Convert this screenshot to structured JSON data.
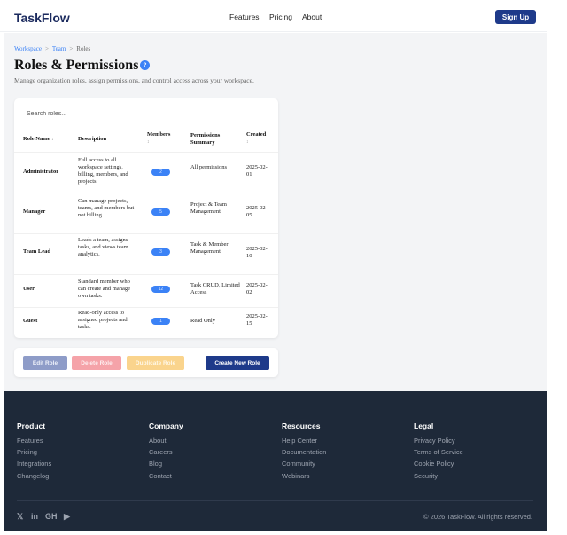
{
  "header": {
    "logo": "TaskFlow",
    "nav": [
      "Features",
      "Pricing",
      "About"
    ],
    "signup_label": "Sign Up"
  },
  "breadcrumb": {
    "items": [
      "Workspace",
      "Team",
      "Roles"
    ],
    "separator": ">"
  },
  "page": {
    "title": "Roles & Permissions",
    "help_icon": "?",
    "subtitle": "Manage organization roles, assign permissions, and control access across your workspace."
  },
  "search": {
    "placeholder": "Search roles..."
  },
  "table": {
    "columns": {
      "role_name": "Role Name",
      "description": "Description",
      "members": "Members",
      "permissions": "Permissions Summary",
      "created": "Created",
      "sort_glyph": "↕"
    },
    "rows": [
      {
        "name": "Administrator",
        "description": "Full access to all workspace settings, billing, members, and projects.",
        "members": "2",
        "permissions": "All permissions",
        "created": "2025-02-01"
      },
      {
        "name": "Manager",
        "description": "Can manage projects, teams, and members but not billing.",
        "members": "5",
        "permissions": "Project & Team Management",
        "created": "2025-02-05"
      },
      {
        "name": "Team Lead",
        "description": "Leads a team, assigns tasks, and views team analytics.",
        "members": "3",
        "permissions": "Task & Member Management",
        "created": "2025-02-10"
      },
      {
        "name": "User",
        "description": "Standard member who can create and manage own tasks.",
        "members": "12",
        "permissions": "Task CRUD, Limited Access",
        "created": "2025-02-02"
      },
      {
        "name": "Guest",
        "description": "Read-only access to assigned projects and tasks.",
        "members": "1",
        "permissions": "Read Only",
        "created": "2025-02-15"
      }
    ]
  },
  "actions": {
    "edit": "Edit Role",
    "delete": "Delete Role",
    "duplicate": "Duplicate Role",
    "create": "Create New Role"
  },
  "footer": {
    "columns": [
      {
        "title": "Product",
        "links": [
          "Features",
          "Pricing",
          "Integrations",
          "Changelog"
        ]
      },
      {
        "title": "Company",
        "links": [
          "About",
          "Careers",
          "Blog",
          "Contact"
        ]
      },
      {
        "title": "Resources",
        "links": [
          "Help Center",
          "Documentation",
          "Community",
          "Webinars"
        ]
      },
      {
        "title": "Legal",
        "links": [
          "Privacy Policy",
          "Terms of Service",
          "Cookie Policy",
          "Security"
        ]
      }
    ],
    "social": {
      "x": "𝕏",
      "linkedin": "in",
      "github": "GH",
      "youtube": "▶"
    },
    "copyright": "© 2026 TaskFlow. All rights reserved."
  },
  "colors": {
    "brand": "#1e3a8a",
    "accent": "#3b82f6",
    "footer_bg": "#1e2939",
    "edit_button": "#8e9cc8",
    "delete_button": "#f5a3a9",
    "duplicate_button": "#fad48d"
  }
}
